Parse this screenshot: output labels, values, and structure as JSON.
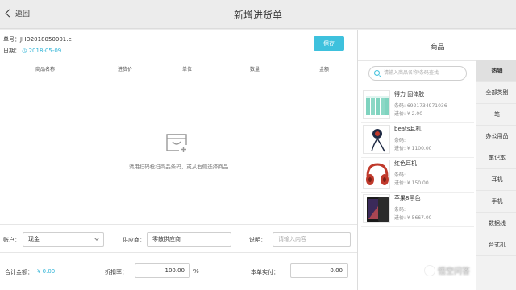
{
  "header": {
    "back_label": "返回",
    "title": "新增进货单"
  },
  "form": {
    "order_no_label": "单号：",
    "order_no": "JHD2018050001.e",
    "date_label": "日期：",
    "date": "2018-05-09",
    "save_label": "保存"
  },
  "table": {
    "headers": [
      "商品名称",
      "进货价",
      "单位",
      "数量",
      "金额"
    ],
    "empty_text": "请用扫码枪扫商品条码，或从右侧选择商品"
  },
  "footer": {
    "account_label": "账户：",
    "account_value": "现金",
    "supplier_label": "供应商：",
    "supplier_value": "零散供应商",
    "remark_label": "说明：",
    "remark_placeholder": "请输入内容",
    "total_label": "合计金额：",
    "total_value": "¥ 0.00",
    "discount_label": "折扣率：",
    "discount_value": "100.00",
    "discount_unit": "%",
    "actual_label": "本单实付：",
    "actual_value": "0.00"
  },
  "panel": {
    "title": "商品",
    "search_placeholder": "请输入商品名称/条码查找",
    "products": [
      {
        "name": "得力 固体胶",
        "code": "条码: 6921734971036",
        "price": "进价: ¥ 2.00",
        "icon": "glue-sticks-image"
      },
      {
        "name": "beats耳机",
        "code": "条码:",
        "price": "进价: ¥ 1100.00",
        "icon": "earbuds-image"
      },
      {
        "name": "红色耳机",
        "code": "条码:",
        "price": "进价: ¥ 150.00",
        "icon": "red-headphones-image"
      },
      {
        "name": "苹果8黑色",
        "code": "条码:",
        "price": "进价: ¥ 5667.00",
        "icon": "iphone-image"
      }
    ],
    "categories": [
      "热销",
      "全部类别",
      "笔",
      "办公用品",
      "笔记本",
      "耳机",
      "手机",
      "数据线",
      "台式机"
    ]
  },
  "watermark": {
    "text": "悟空问答"
  },
  "colors": {
    "accent": "#3ec1dd",
    "link": "#2fb3d6"
  }
}
